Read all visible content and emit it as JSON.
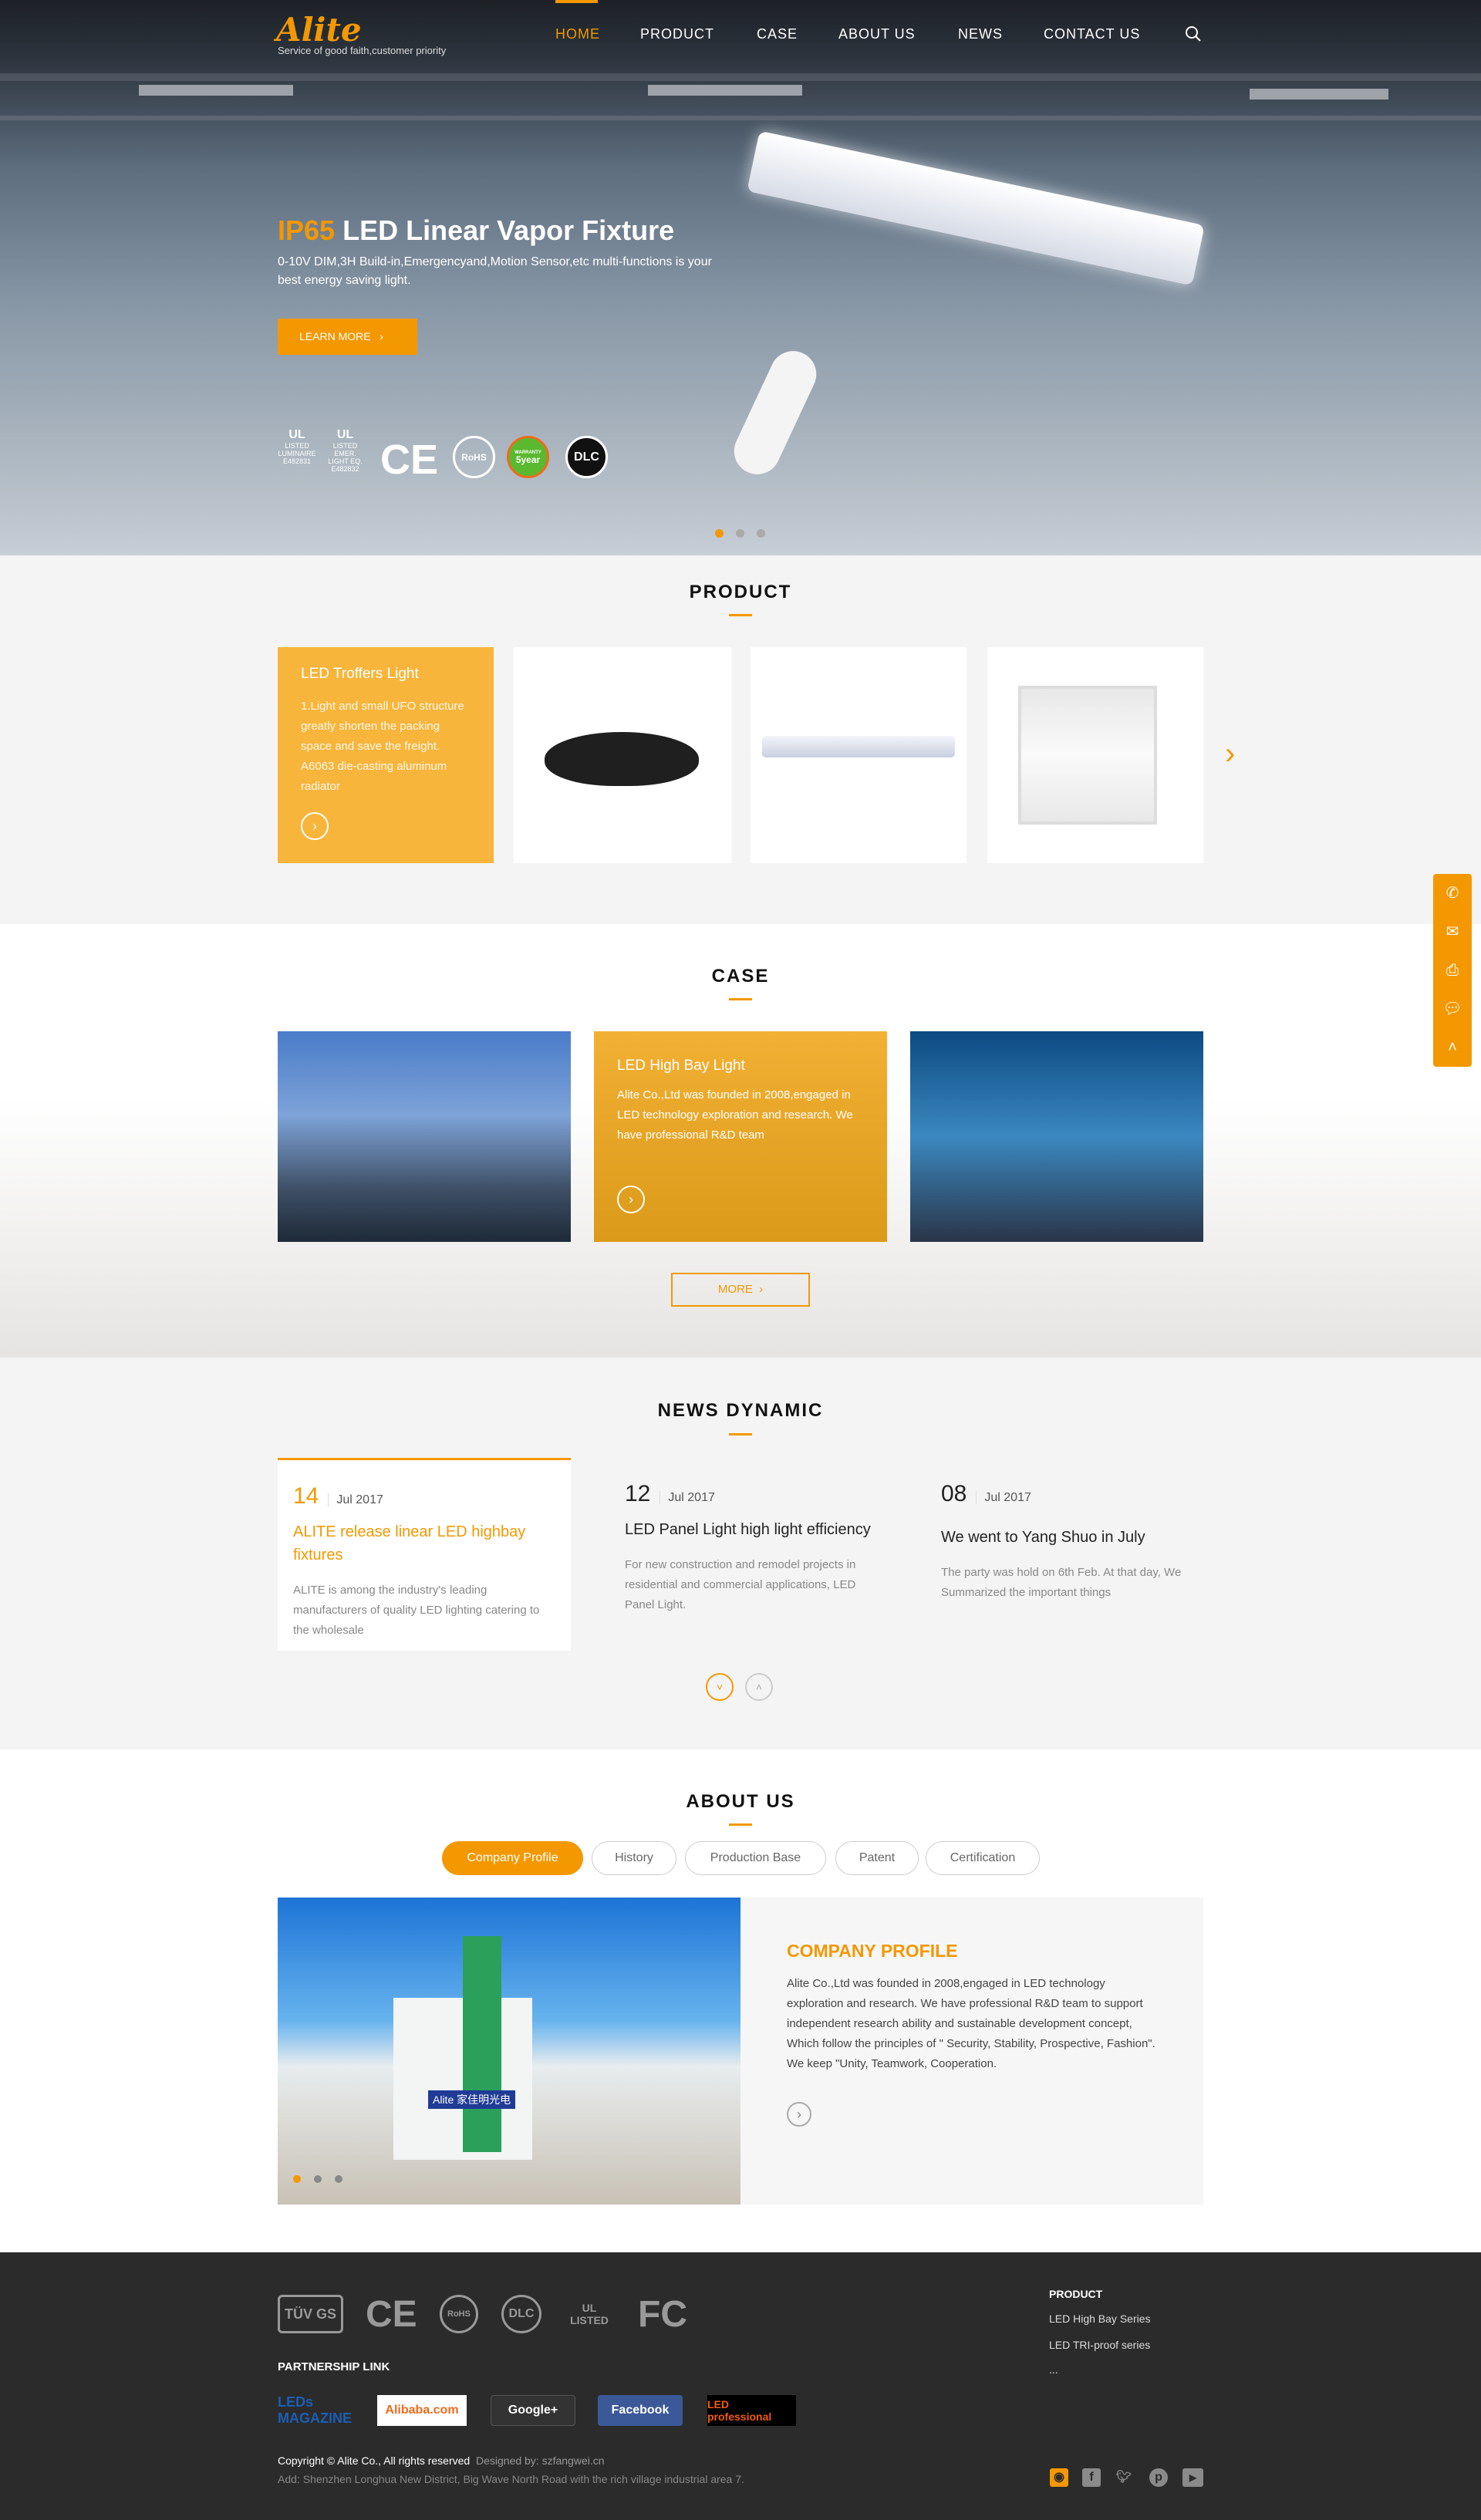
{
  "header": {
    "logo": "Alite",
    "slogan": "Service of good faith,customer priority",
    "nav": [
      "HOME",
      "PRODUCT",
      "CASE",
      "ABOUT US",
      "NEWS",
      "CONTACT US"
    ],
    "active": "HOME",
    "search_icon": "search-icon"
  },
  "hero": {
    "title_highlight": "IP65",
    "title": "LED Linear Vapor Fixture",
    "subtitle": "0-10V DIM,3H Build-in,Emergencyand,Motion Sensor,etc multi-functions is your best energy saving light.",
    "button": "LEARN MORE",
    "certs": [
      {
        "mark": "UL",
        "label": "LISTED",
        "sub": "LUMINAIRE",
        "code": "E482831"
      },
      {
        "mark": "UL",
        "label": "LISTED",
        "sub": "EMER. LIGHT EQ.",
        "code": "E482832"
      },
      {
        "mark": "CE"
      },
      {
        "mark": "RoHS"
      },
      {
        "mark": "5year",
        "label": "WARRANTY"
      },
      {
        "mark": "DLC",
        "label": "LISTED"
      }
    ],
    "slides": 3,
    "active_slide": 1
  },
  "product": {
    "title": "PRODUCT",
    "featured": {
      "name": "LED Troffers Light",
      "desc": "1.Light and small UFO structure greatly shorten the packing space and save the freight. A6063 die-casting aluminum radiator"
    }
  },
  "case": {
    "title": "CASE",
    "featured": {
      "name": "LED High Bay Light",
      "desc": "Alite Co.,Ltd was founded in 2008,engaged in LED technology exploration and research. We have professional R&D team"
    },
    "more": "MORE"
  },
  "news": {
    "title": "NEWS DYNAMIC",
    "items": [
      {
        "day": "14",
        "month": "Jul 2017",
        "title": "ALITE release linear LED highbay fixtures",
        "desc": "ALITE is among the industry's leading manufacturers of quality LED lighting catering to the wholesale"
      },
      {
        "day": "12",
        "month": "Jul 2017",
        "title": "LED Panel Light high light efficiency",
        "desc": "For new construction and remodel projects in residential and commercial applications, LED Panel Light."
      },
      {
        "day": "08",
        "month": "Jul 2017",
        "title": "We went to Yang Shuo in July",
        "desc": "The party was hold on 6th Feb. At that day, We Summarized the important things"
      }
    ]
  },
  "about": {
    "title": "ABOUT US",
    "tabs": [
      "Company Profile",
      "History",
      "Production Base",
      "Patent",
      "Certification"
    ],
    "active_tab": "Company Profile",
    "heading": "COMPANY PROFILE",
    "text": "Alite Co.,Ltd was founded in 2008,engaged in LED technology exploration and research. We have professional R&D team to support independent research ability and sustainable development concept, Which follow the principles of \" Security, Stability, Prospective, Fashion\". We keep \"Unity, Teamwork, Cooperation.",
    "sign_text": "Alite 家佳明光电"
  },
  "footer": {
    "certs": [
      "TÜV GS",
      "CE",
      "RoHS",
      "DLC",
      "UL LISTED",
      "FC"
    ],
    "partnership_title": "PARTNERSHIP LINK",
    "partners": [
      "LEDs MAGAZINE",
      "Alibaba.com",
      "Google+",
      "Facebook",
      "LED professional"
    ],
    "copyright": "Copyright © Alite Co., All rights reserved",
    "designed": "Designed by: szfangwei.cn",
    "address": "Add: Shenzhen Longhua New District, Big Wave North Road with the rich village industrial area 7.",
    "product_title": "PRODUCT",
    "product_links": [
      "LED High Bay Series",
      "LED TRI-proof series",
      "..."
    ],
    "social": [
      "instagram-icon",
      "facebook-icon",
      "twitter-icon",
      "pinterest-icon",
      "youtube-icon"
    ]
  },
  "side": [
    "phone-icon",
    "mail-icon",
    "fax-icon",
    "wechat-icon",
    "back-to-top-icon"
  ],
  "colors": {
    "accent": "#f39800",
    "footer_bg": "#2b2b2b"
  }
}
